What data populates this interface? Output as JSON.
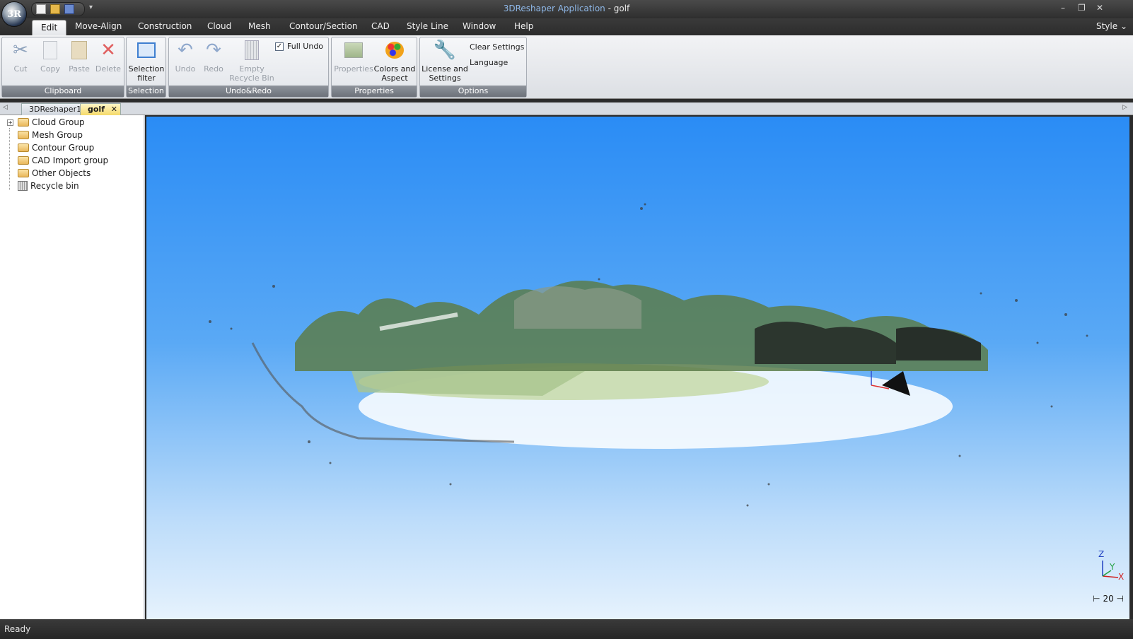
{
  "titlebar": {
    "app_name": "3DReshaper Application",
    "separator": " - ",
    "doc_name": "golf",
    "orb_label": "3R",
    "minimize": "–",
    "restore": "❐",
    "close": "✕"
  },
  "menu": {
    "tabs": [
      "Edit",
      "Move-Align",
      "Construction",
      "Cloud",
      "Mesh",
      "Contour/Section",
      "CAD",
      "Style Line",
      "Window",
      "Help"
    ],
    "active_tab": "Edit",
    "style_label": "Style",
    "style_chevron": "⌄"
  },
  "ribbon": {
    "clipboard": {
      "label": "Clipboard",
      "cut": "Cut",
      "copy": "Copy",
      "paste": "Paste",
      "delete": "Delete"
    },
    "selection": {
      "label": "Selection",
      "selection_filter_line1": "Selection",
      "selection_filter_line2": "filter"
    },
    "undo_redo": {
      "label": "Undo&Redo",
      "undo": "Undo",
      "redo": "Redo",
      "empty_line1": "Empty",
      "empty_line2": "Recycle Bin",
      "full_undo": "Full Undo",
      "full_undo_checked": "✓"
    },
    "properties": {
      "label": "Properties",
      "properties": "Properties",
      "colors_line1": "Colors and",
      "colors_line2": "Aspect"
    },
    "options": {
      "label": "Options",
      "license_line1": "License and",
      "license_line2": "Settings",
      "clear_settings": "Clear Settings",
      "language": "Language"
    }
  },
  "doc_tabs": {
    "tabs": [
      "3DReshaper1",
      "golf"
    ],
    "active": "golf",
    "close_glyph": "✕",
    "left_arrow": "◁",
    "right_arrow": "▷"
  },
  "tree": {
    "expander": "+",
    "items": [
      "Cloud Group",
      "Mesh Group",
      "Contour Group",
      "CAD Import group",
      "Other Objects",
      "Recycle bin"
    ]
  },
  "viewport": {
    "axis_z": "Z",
    "axis_y": "Y",
    "axis_x": "X",
    "scale_value": "20",
    "background_top": "#2a8cf5",
    "background_bottom": "#e6f2fd"
  },
  "status": {
    "text": "Ready"
  },
  "icons": [
    "scissors-icon",
    "copy-icon",
    "paste-icon",
    "delete-x-icon",
    "selection-filter-icon",
    "undo-icon",
    "redo-icon",
    "trash-can-icon",
    "properties-icon",
    "palette-icon",
    "wrench-icon",
    "folder-icon",
    "recycle-bin-icon"
  ]
}
